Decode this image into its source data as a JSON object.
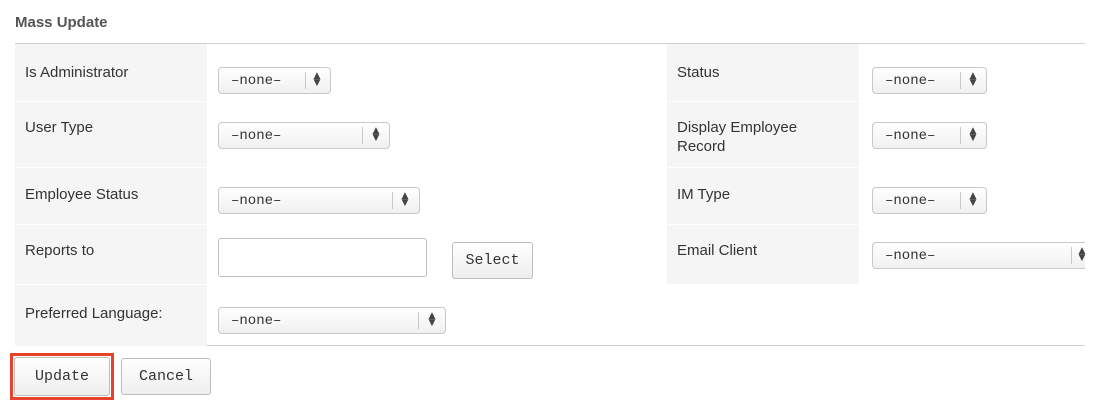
{
  "panel": {
    "title": "Mass Update"
  },
  "fields": {
    "is_administrator": {
      "label": "Is Administrator",
      "value": "–none–"
    },
    "user_type": {
      "label": "User Type",
      "value": "–none–"
    },
    "employee_status": {
      "label": "Employee Status",
      "value": "–none–"
    },
    "reports_to": {
      "label": "Reports to",
      "value": "",
      "button_label": "Select"
    },
    "preferred_language": {
      "label": "Preferred Language:",
      "value": "–none–"
    },
    "status": {
      "label": "Status",
      "value": "–none–"
    },
    "display_employee_record": {
      "label_line1": "Display Employee",
      "label_line2": "Record",
      "value": "–none–"
    },
    "im_type": {
      "label": "IM Type",
      "value": "–none–"
    },
    "email_client": {
      "label": "Email Client",
      "value": "–none–"
    }
  },
  "actions": {
    "update_label": "Update",
    "cancel_label": "Cancel"
  },
  "icons": {
    "select_arrows": "up-down-arrows-icon",
    "arrows_glyph_up": "▲",
    "arrows_glyph_down": "▼"
  },
  "colors": {
    "label_background": "#f5f5f5",
    "highlight": "#e8412d"
  }
}
